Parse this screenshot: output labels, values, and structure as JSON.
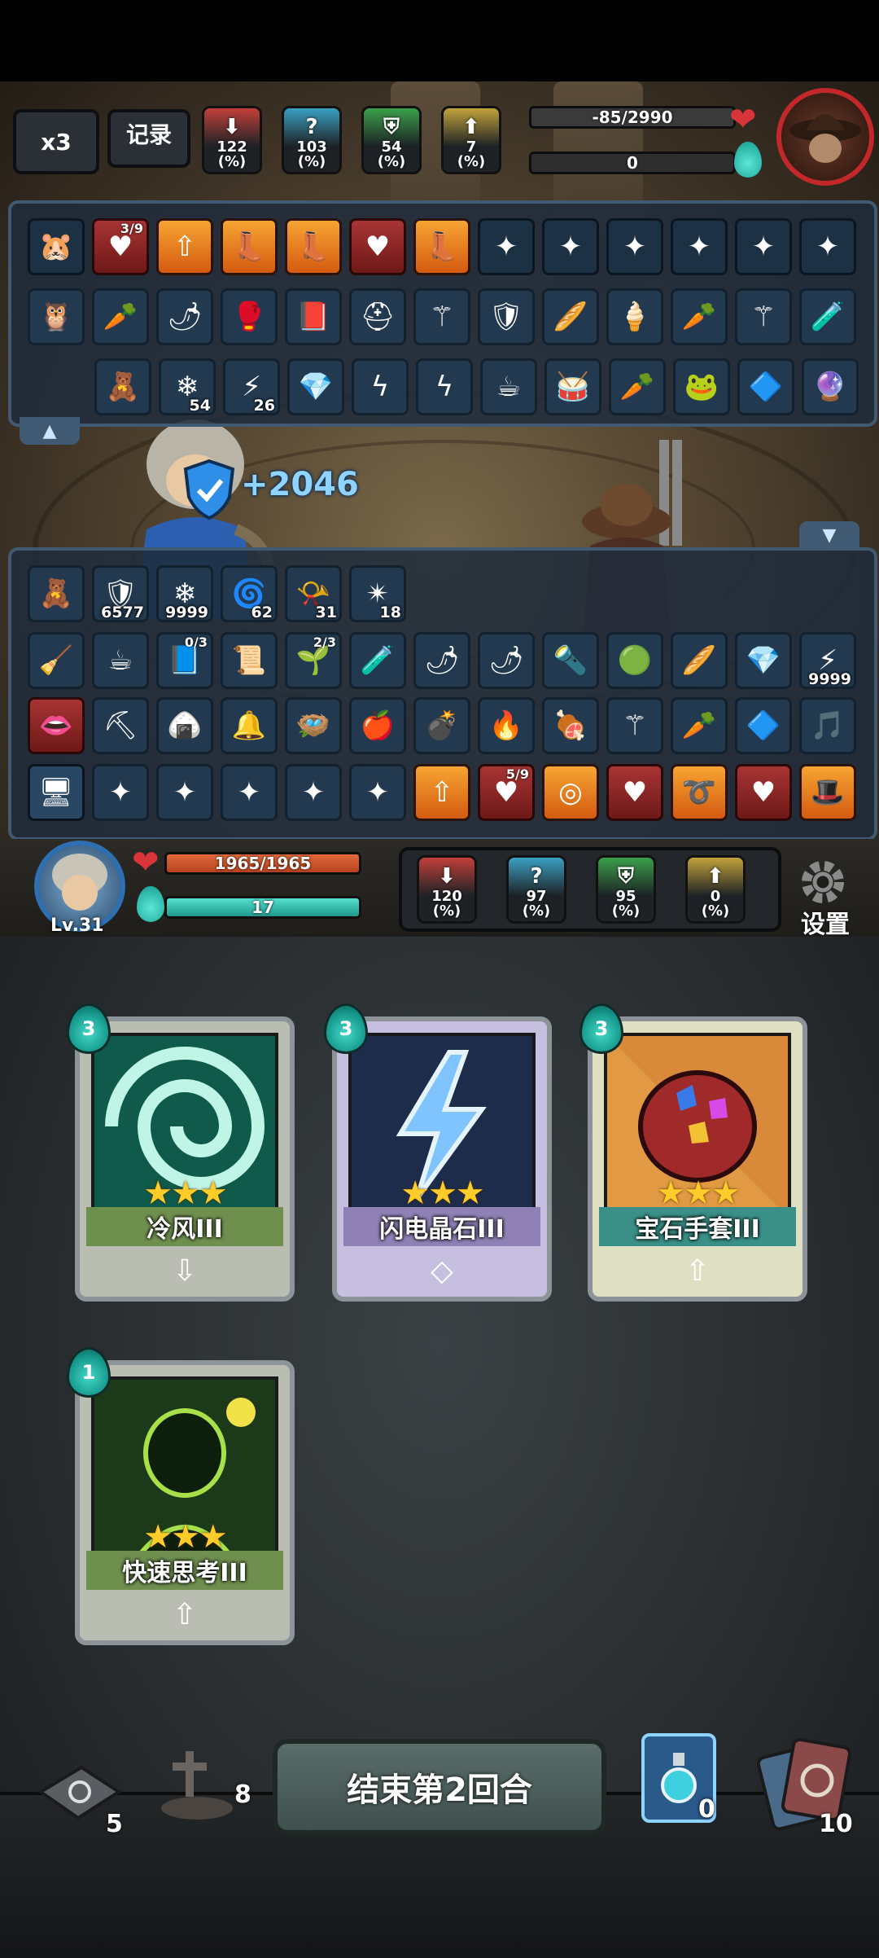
{
  "top_hud": {
    "speed_label": "x3",
    "record_label": "记录",
    "enemy_stats": [
      {
        "icon": "attack-down-icon",
        "value": "122",
        "unit": "(%)",
        "color": "#c2403a"
      },
      {
        "icon": "mystery-icon",
        "value": "103",
        "unit": "(%)",
        "color": "#3aa0c2"
      },
      {
        "icon": "defense-icon",
        "value": "54",
        "unit": "(%)",
        "color": "#3aa04a"
      },
      {
        "icon": "up-arrow-icon",
        "value": "7",
        "unit": "(%)",
        "color": "#c2a23a"
      }
    ],
    "enemy_hp": "-85/2990",
    "enemy_energy": "0"
  },
  "enemy_items": {
    "row1": [
      {
        "icon": "hamster-icon",
        "style": "dark"
      },
      {
        "icon": "heart-buff-icon",
        "style": "red",
        "top": "3/9"
      },
      {
        "icon": "up-arrow-buff-icon",
        "style": "orange"
      },
      {
        "icon": "boot-buff-icon",
        "style": "orange"
      },
      {
        "icon": "boot-buff-icon",
        "style": "orange"
      },
      {
        "icon": "heart-buff-icon",
        "style": "red"
      },
      {
        "icon": "boot-buff-icon",
        "style": "orange"
      },
      {
        "icon": "skill-slot-icon",
        "style": "dark"
      },
      {
        "icon": "skill-slot-icon",
        "style": "dark"
      },
      {
        "icon": "skill-slot-icon",
        "style": "dark"
      },
      {
        "icon": "skill-slot-icon",
        "style": "dark"
      },
      {
        "icon": "skill-slot-icon",
        "style": "dark"
      },
      {
        "icon": "skill-slot-icon",
        "style": "dark"
      }
    ],
    "row2": [
      {
        "icon": "owl-icon"
      },
      {
        "icon": "carrot-icon"
      },
      {
        "icon": "chili-icon"
      },
      {
        "icon": "glove-icon"
      },
      {
        "icon": "book-icon"
      },
      {
        "icon": "helmet-icon"
      },
      {
        "icon": "staff-icon"
      },
      {
        "icon": "shield-icon"
      },
      {
        "icon": "baguette-icon"
      },
      {
        "icon": "ice-cream-icon"
      },
      {
        "icon": "carrot-icon"
      },
      {
        "icon": "staff-icon"
      },
      {
        "icon": "potion-icon"
      }
    ],
    "row3": [
      {
        "icon": "scarecrow-icon"
      },
      {
        "icon": "snowflake-icon",
        "count": "54"
      },
      {
        "icon": "lightning-icon",
        "count": "26"
      },
      {
        "icon": "crystal-icon"
      },
      {
        "icon": "lightning-crystal-icon"
      },
      {
        "icon": "lightning-crystal-icon"
      },
      {
        "icon": "teacup-icon"
      },
      {
        "icon": "drum-icon"
      },
      {
        "icon": "carrot-icon"
      },
      {
        "icon": "frog-icon"
      },
      {
        "icon": "gem-cluster-icon"
      },
      {
        "icon": "crystal-ball-icon"
      }
    ]
  },
  "shield_gain": "+2046",
  "player_items": {
    "row1": [
      {
        "icon": "scarecrow-icon"
      },
      {
        "icon": "shield-icon",
        "count": "6577"
      },
      {
        "icon": "snowflake-icon",
        "count": "9999"
      },
      {
        "icon": "vortex-icon",
        "count": "62"
      },
      {
        "icon": "horn-icon",
        "count": "31"
      },
      {
        "icon": "spark-icon",
        "count": "18"
      }
    ],
    "row2": [
      {
        "icon": "broom-icon"
      },
      {
        "icon": "teacup-icon"
      },
      {
        "icon": "spellbook-icon",
        "top": "0/3"
      },
      {
        "icon": "scroll-icon"
      },
      {
        "icon": "plant-icon",
        "top": "2/3"
      },
      {
        "icon": "potion-icon"
      },
      {
        "icon": "chili-icon"
      },
      {
        "icon": "chili-icon"
      },
      {
        "icon": "torch-icon"
      },
      {
        "icon": "slime-icon"
      },
      {
        "icon": "baguette-icon"
      },
      {
        "icon": "crystal-icon"
      },
      {
        "icon": "lightning-icon",
        "count": "9999"
      }
    ],
    "row3": [
      {
        "icon": "lips-icon",
        "style": "red"
      },
      {
        "icon": "miner-icon"
      },
      {
        "icon": "onigiri-icon"
      },
      {
        "icon": "bell-icon"
      },
      {
        "icon": "nest-icon"
      },
      {
        "icon": "apple-icon"
      },
      {
        "icon": "bomb-icon"
      },
      {
        "icon": "fire-cup-icon"
      },
      {
        "icon": "meat-icon"
      },
      {
        "icon": "staff-icon"
      },
      {
        "icon": "carrot-icon"
      },
      {
        "icon": "gem-cluster-icon"
      },
      {
        "icon": "harp-icon"
      }
    ],
    "row4": [
      {
        "icon": "monitor-icon",
        "style": "bright"
      },
      {
        "icon": "skill-slot-icon"
      },
      {
        "icon": "skill-slot-icon"
      },
      {
        "icon": "skill-slot-icon"
      },
      {
        "icon": "skill-slot-icon"
      },
      {
        "icon": "skill-slot-icon"
      },
      {
        "icon": "up-arrow-buff-icon",
        "style": "orange"
      },
      {
        "icon": "heart-buff-icon",
        "style": "red",
        "top": "5/9"
      },
      {
        "icon": "ring-buff-icon",
        "style": "orange"
      },
      {
        "icon": "heart-buff-icon",
        "style": "red"
      },
      {
        "icon": "swirl-buff-icon",
        "style": "orange"
      },
      {
        "icon": "heart-buff-icon",
        "style": "red"
      },
      {
        "icon": "hat-buff-icon",
        "style": "orange"
      }
    ]
  },
  "player_hud": {
    "level": "Lv.31",
    "hp": "1965/1965",
    "energy": "17",
    "stats": [
      {
        "icon": "attack-down-icon",
        "value": "120",
        "unit": "(%)",
        "color": "#c2403a"
      },
      {
        "icon": "mystery-icon",
        "value": "97",
        "unit": "(%)",
        "color": "#3aa0c2"
      },
      {
        "icon": "defense-icon",
        "value": "95",
        "unit": "(%)",
        "color": "#3aa04a"
      },
      {
        "icon": "up-arrow-icon",
        "value": "0",
        "unit": "(%)",
        "color": "#c2a23a"
      }
    ],
    "settings_label": "设置"
  },
  "cards": [
    {
      "cost": "3",
      "name": "冷风III",
      "stars": "★★★",
      "art": "vortex",
      "name_bg": "#6f8f4f",
      "foot_bg": "#b9bdb2",
      "foot": "⇩"
    },
    {
      "cost": "3",
      "name": "闪电晶石III",
      "stars": "★★★",
      "art": "lightning-crystal",
      "name_bg": "#8f80b5",
      "foot_bg": "#c7bfe0",
      "foot": "◇"
    },
    {
      "cost": "3",
      "name": "宝石手套III",
      "stars": "★★★",
      "art": "gem-gauntlet",
      "name_bg": "#3a8f86",
      "foot_bg": "#dfe0c3",
      "foot": "⇧"
    },
    {
      "cost": "1",
      "name": "快速思考III",
      "stars": "★★★",
      "art": "quick-think",
      "name_bg": "#6f8f4f",
      "foot_bg": "#b9bdb2",
      "foot": "⇧"
    }
  ],
  "bottom": {
    "draw_pile": "5",
    "discard_pile": "8",
    "end_turn_label": "结束第2回合",
    "potion_count": "0",
    "exhaust_pile": "10"
  }
}
